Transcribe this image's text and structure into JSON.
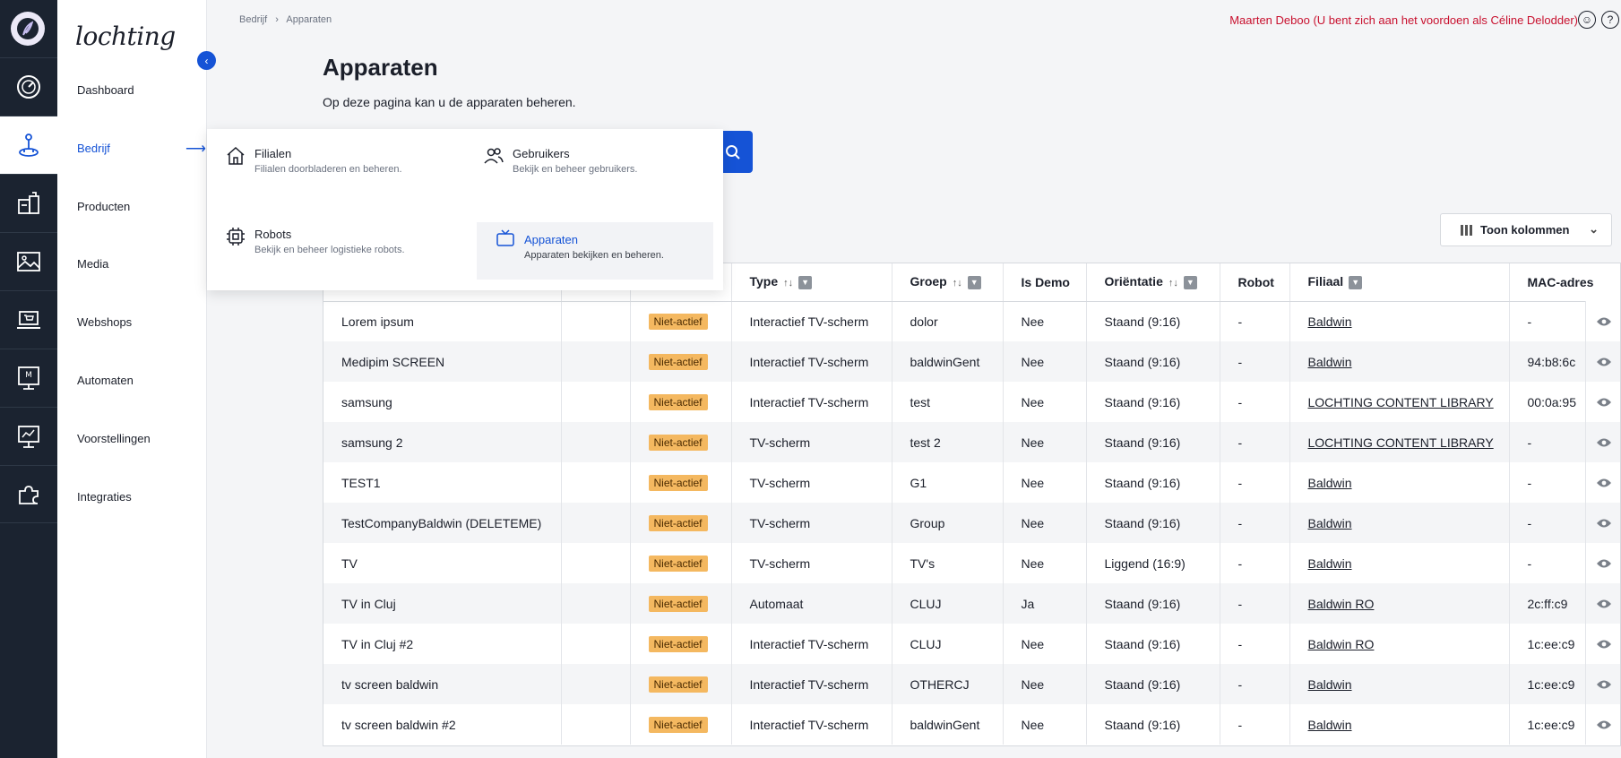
{
  "breadcrumb": [
    "Bedrijf",
    "Apparaten"
  ],
  "user_text": "Maarten Deboo (U bent zich aan het voordoen als Céline Delodder)",
  "brand": "lochting",
  "nav": [
    {
      "label": "Dashboard",
      "icon": "gauge-icon"
    },
    {
      "label": "Bedrijf",
      "icon": "joystick-icon"
    },
    {
      "label": "Producten",
      "icon": "products-icon"
    },
    {
      "label": "Media",
      "icon": "image-icon"
    },
    {
      "label": "Webshops",
      "icon": "laptop-cart-icon"
    },
    {
      "label": "Automaten",
      "icon": "vending-machine-icon"
    },
    {
      "label": "Voorstellingen",
      "icon": "presentation-icon"
    },
    {
      "label": "Integraties",
      "icon": "puzzle-icon"
    }
  ],
  "active_nav": "Bedrijf",
  "page": {
    "title": "Apparaten",
    "subtitle": "Op deze pagina kan u de apparaten beheren."
  },
  "dropdown": [
    {
      "title": "Filialen",
      "desc": "Filialen doorbladeren en beheren.",
      "icon": "house-icon"
    },
    {
      "title": "Gebruikers",
      "desc": "Bekijk en beheer gebruikers.",
      "icon": "users-icon"
    },
    {
      "title": "Robots",
      "desc": "Bekijk en beheer logistieke robots.",
      "icon": "chip-icon"
    },
    {
      "title": "Apparaten",
      "desc": "Apparaten bekijken en beheren.",
      "icon": "tv-icon"
    }
  ],
  "toon_kolommen": "Toon kolommen",
  "table": {
    "headers": [
      "",
      "",
      "",
      "Type",
      "Groep",
      "Is Demo",
      "Oriëntatie",
      "Robot",
      "Filiaal",
      "MAC-adres"
    ],
    "rows": [
      {
        "name": "Lorem ipsum",
        "status": "Niet-actief",
        "type": "Interactief TV-scherm",
        "groep": "dolor",
        "demo": "Nee",
        "orientatie": "Staand (9:16)",
        "robot": "-",
        "filiaal": "Baldwin",
        "mac": "-"
      },
      {
        "name": "Medipim SCREEN",
        "status": "Niet-actief",
        "type": "Interactief TV-scherm",
        "groep": "baldwinGent",
        "demo": "Nee",
        "orientatie": "Staand (9:16)",
        "robot": "-",
        "filiaal": "Baldwin",
        "mac": "94:b8:6c"
      },
      {
        "name": "samsung",
        "status": "Niet-actief",
        "type": "Interactief TV-scherm",
        "groep": "test",
        "demo": "Nee",
        "orientatie": "Staand (9:16)",
        "robot": "-",
        "filiaal": "LOCHTING CONTENT LIBRARY",
        "mac": "00:0a:95"
      },
      {
        "name": "samsung 2",
        "status": "Niet-actief",
        "type": "TV-scherm",
        "groep": "test 2",
        "demo": "Nee",
        "orientatie": "Staand (9:16)",
        "robot": "-",
        "filiaal": "LOCHTING CONTENT LIBRARY",
        "mac": "-"
      },
      {
        "name": "TEST1",
        "status": "Niet-actief",
        "type": "TV-scherm",
        "groep": "G1",
        "demo": "Nee",
        "orientatie": "Staand (9:16)",
        "robot": "-",
        "filiaal": "Baldwin",
        "mac": "-"
      },
      {
        "name": "TestCompanyBaldwin (DELETEME)",
        "status": "Niet-actief",
        "type": "TV-scherm",
        "groep": "Group",
        "demo": "Nee",
        "orientatie": "Staand (9:16)",
        "robot": "-",
        "filiaal": "Baldwin",
        "mac": "-"
      },
      {
        "name": "TV",
        "status": "Niet-actief",
        "type": "TV-scherm",
        "groep": "TV's",
        "demo": "Nee",
        "orientatie": "Liggend (16:9)",
        "robot": "-",
        "filiaal": "Baldwin",
        "mac": "-"
      },
      {
        "name": "TV in Cluj",
        "status": "Niet-actief",
        "type": "Automaat",
        "groep": "CLUJ",
        "demo": "Ja",
        "orientatie": "Staand (9:16)",
        "robot": "-",
        "filiaal": "Baldwin RO",
        "mac": "2c:ff:c9"
      },
      {
        "name": "TV in Cluj #2",
        "status": "Niet-actief",
        "type": "Interactief TV-scherm",
        "groep": "CLUJ",
        "demo": "Nee",
        "orientatie": "Staand (9:16)",
        "robot": "-",
        "filiaal": "Baldwin RO",
        "mac": "1c:ee:c9"
      },
      {
        "name": "tv screen baldwin",
        "status": "Niet-actief",
        "type": "Interactief TV-scherm",
        "groep": "OTHERCJ",
        "demo": "Nee",
        "orientatie": "Staand (9:16)",
        "robot": "-",
        "filiaal": "Baldwin",
        "mac": "1c:ee:c9"
      },
      {
        "name": "tv screen baldwin #2",
        "status": "Niet-actief",
        "type": "Interactief TV-scherm",
        "groep": "baldwinGent",
        "demo": "Nee",
        "orientatie": "Staand (9:16)",
        "robot": "-",
        "filiaal": "Baldwin",
        "mac": "1c:ee:c9"
      }
    ]
  },
  "colors": {
    "accent": "#1553d6",
    "badge": "#f4b860",
    "user_text": "#c8102e",
    "rail": "#1b2330"
  }
}
